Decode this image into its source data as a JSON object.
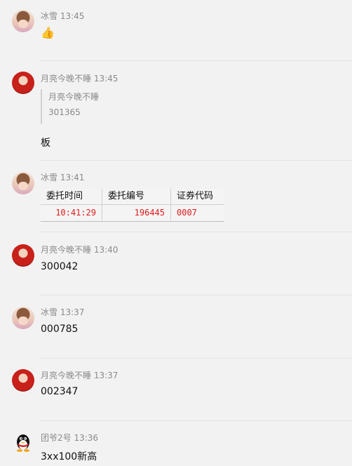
{
  "messages": [
    {
      "avatar": "bingxue",
      "meta": "冰雪 13:45",
      "emoji": "👍"
    },
    {
      "avatar": "yueliang",
      "meta": "月亮今晚不睡 13:45",
      "quote": {
        "author": "月亮今晚不睡",
        "text": "301365"
      },
      "text": "板"
    },
    {
      "avatar": "bingxue",
      "meta": "冰雪 13:41",
      "image": {
        "headers": [
          "委托时间",
          "委托编号",
          "证券代码"
        ],
        "row": [
          "10:41:29",
          "196445",
          "0007"
        ]
      }
    },
    {
      "avatar": "yueliang",
      "meta": "月亮今晚不睡 13:40",
      "text": "300042"
    },
    {
      "avatar": "bingxue",
      "meta": "冰雪 13:37",
      "text": "000785"
    },
    {
      "avatar": "yueliang",
      "meta": "月亮今晚不睡 13:37",
      "text": "002347"
    },
    {
      "avatar": "tuanye",
      "meta": "团爷2号 13:36",
      "text": "3xx100新高"
    }
  ]
}
